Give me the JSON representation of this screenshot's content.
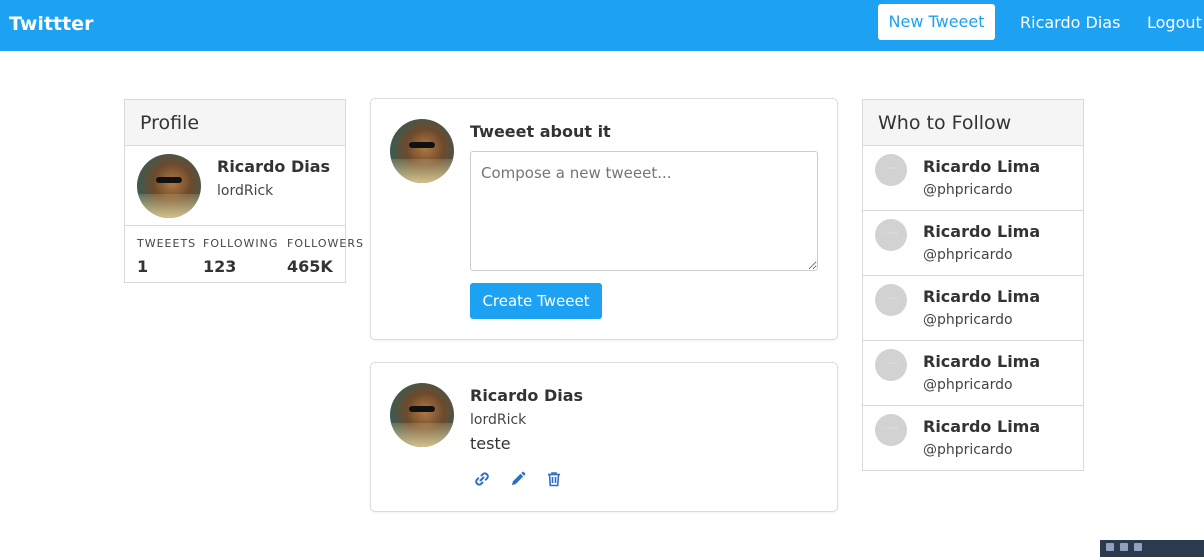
{
  "navbar": {
    "brand": "Twittter",
    "new_tweet": "New Tweeet",
    "user_name": "Ricardo Dias",
    "logout": "Logout"
  },
  "profile": {
    "heading": "Profile",
    "name": "Ricardo Dias",
    "handle": "lordRick",
    "stats": [
      {
        "label": "TWEEETS",
        "value": "1"
      },
      {
        "label": "FOLLOWING",
        "value": "123"
      },
      {
        "label": "FOLLOWERS",
        "value": "465K"
      }
    ]
  },
  "compose": {
    "heading": "Tweeet about it",
    "placeholder": "Compose a new tweeet...",
    "submit": "Create Tweeet"
  },
  "tweet": {
    "name": "Ricardo Dias",
    "handle": "lordRick",
    "text": "teste",
    "actions": [
      "link-icon",
      "edit-icon",
      "trash-icon"
    ]
  },
  "who_to_follow": {
    "heading": "Who to Follow",
    "items": [
      {
        "name": "Ricardo Lima",
        "handle": "@phpricardo"
      },
      {
        "name": "Ricardo Lima",
        "handle": "@phpricardo"
      },
      {
        "name": "Ricardo Lima",
        "handle": "@phpricardo"
      },
      {
        "name": "Ricardo Lima",
        "handle": "@phpricardo"
      },
      {
        "name": "Ricardo Lima",
        "handle": "@phpricardo"
      }
    ]
  },
  "colors": {
    "brand": "#1da1f2",
    "icon": "#2d6fc4"
  }
}
